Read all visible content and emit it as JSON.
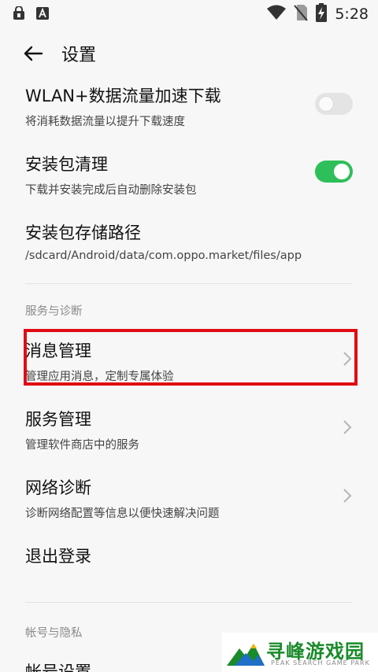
{
  "status_bar": {
    "time": "5:28",
    "left_icons": [
      "lock-app-icon",
      "app-a-icon"
    ],
    "right_icons": [
      "wifi-icon",
      "no-sim-icon",
      "battery-charging-icon"
    ]
  },
  "header": {
    "title": "设置"
  },
  "items": [
    {
      "title": "WLAN+数据流量加速下载",
      "subtitle": "将消耗数据流量以提升下载速度",
      "control": "toggle",
      "state": "off"
    },
    {
      "title": "安装包清理",
      "subtitle": "下载并安装完成后自动删除安装包",
      "control": "toggle",
      "state": "on"
    },
    {
      "title": "安装包存储路径",
      "subtitle": "/sdcard/Android/data/com.oppo.market/files/app"
    }
  ],
  "sections": [
    {
      "header": "服务与诊断",
      "items": [
        {
          "title": "消息管理",
          "subtitle": "管理应用消息，定制专属体验",
          "control": "chevron"
        },
        {
          "title": "服务管理",
          "subtitle": "管理软件商店中的服务",
          "control": "chevron"
        },
        {
          "title": "网络诊断",
          "subtitle": "诊断网络配置等信息以便快速解决问题",
          "control": "chevron"
        },
        {
          "title": "退出登录"
        }
      ]
    },
    {
      "header": "帐号与隐私",
      "items": [
        {
          "title": "帐号设置"
        }
      ]
    }
  ],
  "colors": {
    "toggle_on": "#2fbf5a",
    "toggle_off": "#e4e4e4",
    "highlight": "#e00c13",
    "background": "#f7f7f7"
  },
  "watermark": {
    "title": "寻峰游戏园",
    "subtitle": "PEAK SEARCH GAME PARK"
  }
}
